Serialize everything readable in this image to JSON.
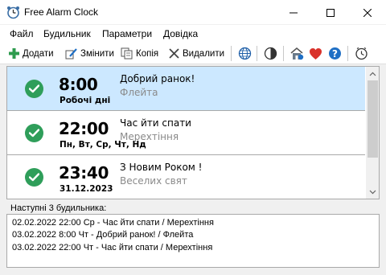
{
  "window": {
    "title": "Free Alarm Clock"
  },
  "menu": {
    "items": [
      "Файл",
      "Будильник",
      "Параметри",
      "Довідка"
    ]
  },
  "toolbar": {
    "add_label": "Додати",
    "edit_label": "Змінити",
    "copy_label": "Копія",
    "delete_label": "Видалити",
    "icons": [
      "globe-icon",
      "contrast-icon",
      "home-icon",
      "heart-icon",
      "help-icon",
      "clock-icon"
    ]
  },
  "alarms": [
    {
      "time": "8:00",
      "days": "Робочі дні",
      "label": "Добрий ранок!",
      "sound": "Флейта",
      "enabled": true,
      "selected": true
    },
    {
      "time": "22:00",
      "days": "Пн, Вт, Ср, Чт, Нд",
      "label": "Час йти спати",
      "sound": "Мерехтіння",
      "enabled": true,
      "selected": false
    },
    {
      "time": "23:40",
      "days": "31.12.2023",
      "label": "З Новим Роком !",
      "sound": "Веселих свят",
      "enabled": true,
      "selected": false
    }
  ],
  "next_alarms": {
    "heading": "Наступні 3 будильника:",
    "lines": [
      "02.02.2022 22:00 Ср - Час йти спати / Мерехтіння",
      "03.02.2022 8:00 Чт - Добрий ранок! / Флейта",
      "03.02.2022 22:00 Чт - Час йти спати / Мерехтіння"
    ]
  },
  "colors": {
    "check_green": "#2f9e5a",
    "selection_blue": "#cce8ff",
    "add_green": "#2e9b4e",
    "heart_red": "#d9322b",
    "help_blue": "#1f6fc5"
  }
}
